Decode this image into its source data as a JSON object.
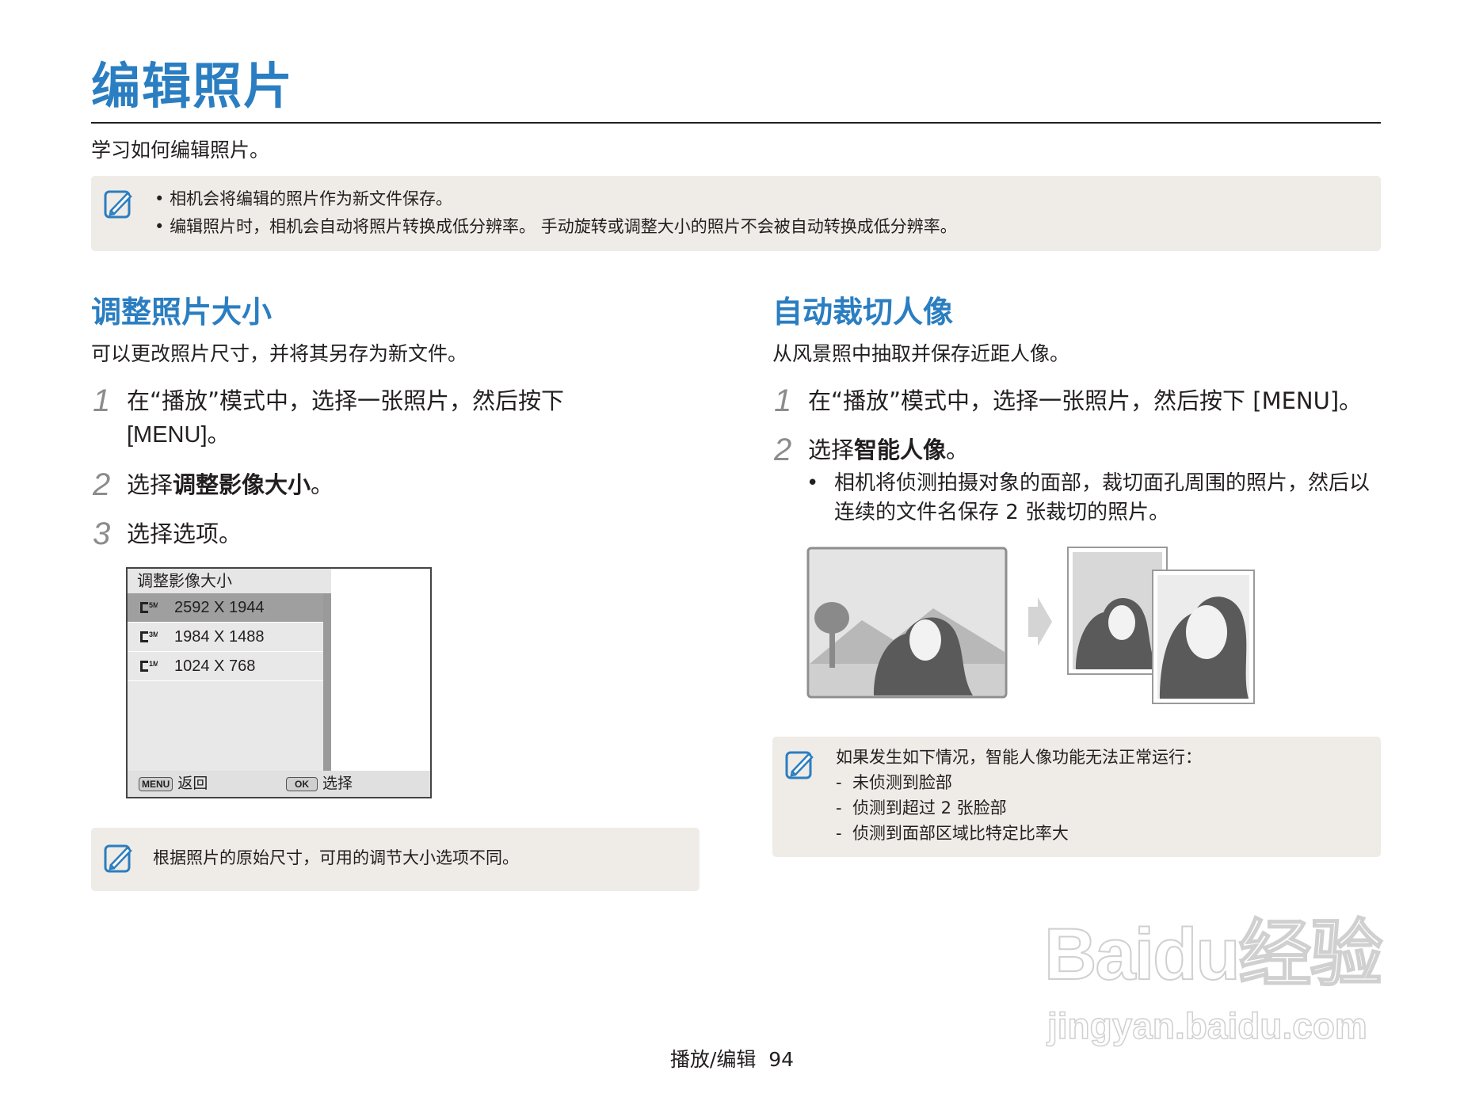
{
  "header": {
    "title": "编辑照片",
    "lead": "学习如何编辑照片。"
  },
  "top_note": {
    "icon": "note-icon",
    "items": [
      "相机会将编辑的照片作为新文件保存。",
      "编辑照片时，相机会自动将照片转换成低分辨率。 手动旋转或调整大小的照片不会被自动转换成低分辨率。"
    ]
  },
  "left": {
    "title": "调整照片大小",
    "subtitle": "可以更改照片尺寸，并将其另存为新文件。",
    "steps": [
      {
        "num": "1",
        "line1": "在“播放”模式中，选择一张照片，然后按下",
        "line2": "[MENU]。"
      },
      {
        "num": "2",
        "prefix": "选择",
        "bold": "调整影像大小",
        "suffix": "。"
      },
      {
        "num": "3",
        "text": "选择选项。"
      }
    ],
    "camera_screen": {
      "header": "调整影像大小",
      "options": [
        {
          "icon": "5m-size-icon",
          "badge": "5M",
          "label": "2592 X 1944",
          "selected": true
        },
        {
          "icon": "3m-size-icon",
          "badge": "3M",
          "label": "1984 X 1488",
          "selected": false
        },
        {
          "icon": "1m-size-icon",
          "badge": "1M",
          "label": "1024 X 768",
          "selected": false
        }
      ],
      "footer_menu_key": "MENU",
      "footer_back": "返回",
      "footer_ok_key": "OK",
      "footer_select": "选择"
    },
    "note": "根据照片的原始尺寸，可用的调节大小选项不同。"
  },
  "right": {
    "title": "自动裁切人像",
    "subtitle": "从风景照中抽取并保存近距人像。",
    "steps": [
      {
        "num": "1",
        "text": "在“播放”模式中，选择一张照片，然后按下 [MENU]。"
      },
      {
        "num": "2",
        "prefix": "选择",
        "bold": "智能人像",
        "suffix": "。"
      }
    ],
    "bullet": "相机将侦测拍摄对象的面部，裁切面孔周围的照片，然后以连续的文件名保存 2 张裁切的照片。",
    "note": {
      "intro": "如果发生如下情况，智能人像功能无法正常运行：",
      "items": [
        "未侦测到脸部",
        "侦测到超过 2 张脸部",
        "侦测到面部区域比特定比率大"
      ]
    }
  },
  "footer": {
    "section": "播放/编辑",
    "page": "94"
  },
  "watermark": {
    "brand": "Baidu经验",
    "url": "jingyan.baidu.com"
  },
  "colors": {
    "accent": "#2a7ec1",
    "note_bg": "#efebe6",
    "step_number": "#8c8c8c"
  }
}
